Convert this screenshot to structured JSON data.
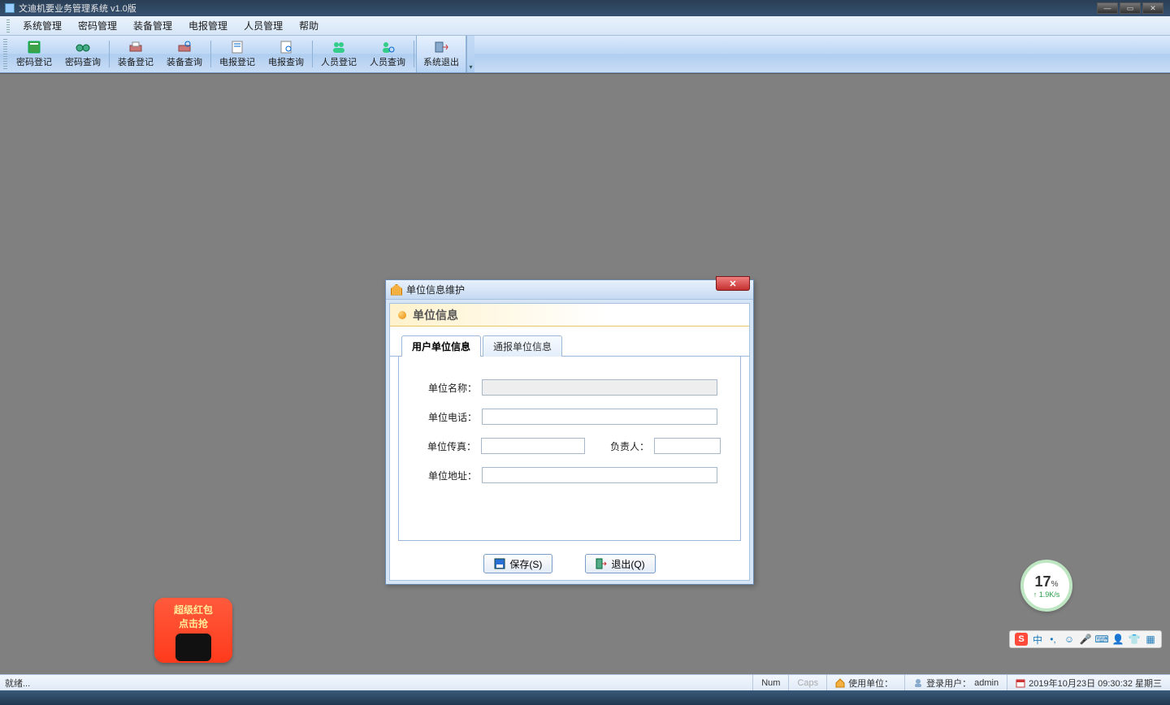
{
  "app": {
    "title": "文迪机要业务管理系统 v1.0版"
  },
  "menu": {
    "system": "系统管理",
    "password": "密码管理",
    "equipment": "装备管理",
    "telegram": "电报管理",
    "personnel": "人员管理",
    "help": "帮助"
  },
  "toolbar": {
    "pwd_reg": "密码登记",
    "pwd_query": "密码查询",
    "eq_reg": "装备登记",
    "eq_query": "装备查询",
    "tel_reg": "电报登记",
    "tel_query": "电报查询",
    "per_reg": "人员登记",
    "per_query": "人员查询",
    "exit": "系统退出"
  },
  "dialog": {
    "title": "单位信息维护",
    "section": "单位信息",
    "tabs": {
      "user_unit": "用户单位信息",
      "report_unit": "通报单位信息"
    },
    "fields": {
      "name_label": "单位名称：",
      "phone_label": "单位电话：",
      "fax_label": "单位传真：",
      "leader_label": "负责人：",
      "addr_label": "单位地址：",
      "name_value": "",
      "phone_value": "",
      "fax_value": "",
      "leader_value": "",
      "addr_value": ""
    },
    "buttons": {
      "save": "保存(S)",
      "exit": "退出(Q)"
    }
  },
  "statusbar": {
    "ready": "就绪...",
    "num": "Num",
    "caps": "Caps",
    "unit_label": "使用单位：",
    "unit_value": "",
    "user_label": "登录用户：",
    "user_value": "admin",
    "datetime": "2019年10月23日 09:30:32 星期三"
  },
  "net_widget": {
    "percent": "17",
    "unit": "%",
    "speed": "1.9K/s"
  },
  "promo": {
    "line1": "超级红包",
    "line2": "点击抢"
  },
  "ime": {
    "lang": "中"
  }
}
